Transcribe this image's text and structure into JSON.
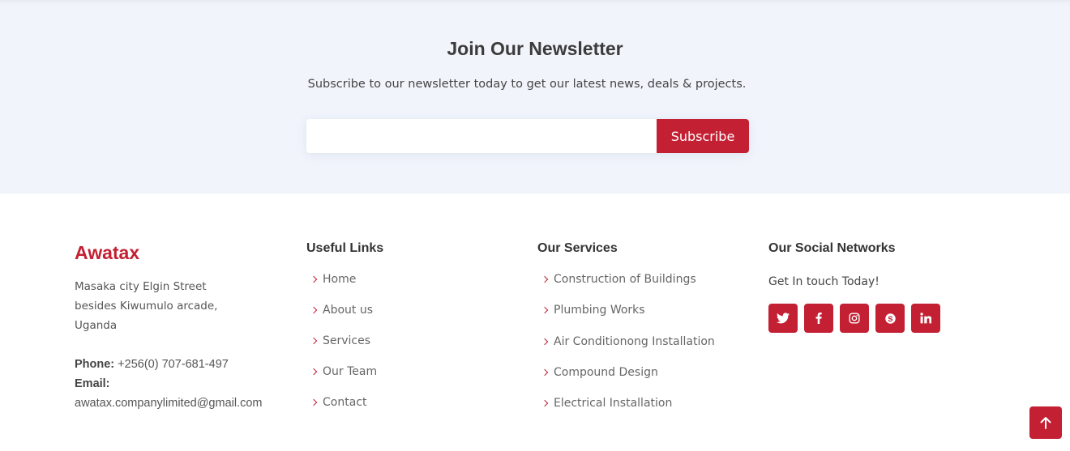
{
  "newsletter": {
    "title": "Join Our Newsletter",
    "subtitle": "Subscribe to our newsletter today to get our latest news, deals & projects.",
    "email_value": "",
    "email_placeholder": "",
    "button_label": "Subscribe"
  },
  "footer": {
    "brand": {
      "name": "Awatax",
      "address_lines": [
        "Masaka city Elgin Street",
        "besides Kiwumulo arcade,",
        "Uganda"
      ],
      "phone_label": "Phone:",
      "phone": "+256(0) 707-681-497",
      "email_label": "Email:",
      "email": "awatax.companylimited@gmail.com"
    },
    "useful_links": {
      "title": "Useful Links",
      "items": [
        "Home",
        "About us",
        "Services",
        "Our Team",
        "Contact"
      ]
    },
    "services": {
      "title": "Our Services",
      "items": [
        "Construction of Buildings",
        "Plumbing Works",
        "Air Conditionong Installation",
        "Compound Design",
        "Electrical Installation"
      ]
    },
    "social": {
      "title": "Our Social Networks",
      "text": "Get In touch Today!",
      "icons": [
        "twitter-icon",
        "facebook-icon",
        "instagram-icon",
        "skype-icon",
        "linkedin-icon"
      ]
    }
  },
  "colors": {
    "accent": "#c32033",
    "newsletter_bg": "#f1f4fb",
    "heading": "#333333",
    "text": "#555555"
  },
  "back_to_top_icon": "arrow-up-icon"
}
